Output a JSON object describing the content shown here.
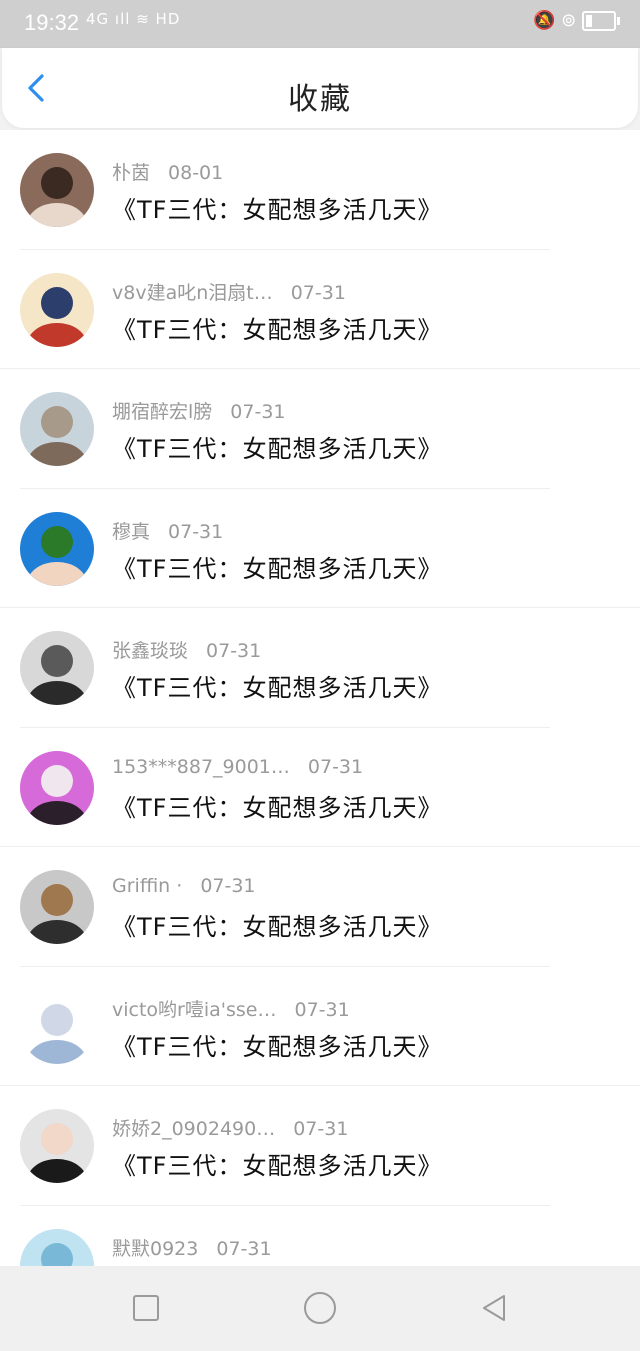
{
  "status": {
    "time": "19:32",
    "signal": "4G ıll ≋ HD",
    "right_icons": "🔕 ⊚"
  },
  "header": {
    "title": "收藏",
    "back_icon": "chevron-left-icon",
    "accent": "#2e8ff0"
  },
  "items": [
    {
      "user": "朴茵",
      "date": "08-01",
      "book": "《TF三代：女配想多活几天》",
      "avatar_colors": [
        "#8a6a5a",
        "#e8d8cc",
        "#3a2a22"
      ]
    },
    {
      "user": "v8v建a叱n泪扇t…",
      "date": "07-31",
      "book": "《TF三代：女配想多活几天》",
      "avatar_colors": [
        "#f5e6c8",
        "#c0392b",
        "#2c3e6b"
      ]
    },
    {
      "user": "堋宿醉宏l膀",
      "date": "07-31",
      "book": "《TF三代：女配想多活几天》",
      "avatar_colors": [
        "#c8d4dc",
        "#7d6a5a",
        "#a89a8a"
      ]
    },
    {
      "user": "穆真",
      "date": "07-31",
      "book": "《TF三代：女配想多活几天》",
      "avatar_colors": [
        "#1f7fd6",
        "#f2d5c0",
        "#2a7a2a"
      ]
    },
    {
      "user": "张鑫琰琰",
      "date": "07-31",
      "book": "《TF三代：女配想多活几天》",
      "avatar_colors": [
        "#d8d8d8",
        "#2a2a2a",
        "#5a5a5a"
      ]
    },
    {
      "user": "153***887_9001…",
      "date": "07-31",
      "book": "《TF三代：女配想多活几天》",
      "avatar_colors": [
        "#d66ad8",
        "#2a1f2a",
        "#f0e6ee"
      ]
    },
    {
      "user": "Griffin ·",
      "date": "07-31",
      "book": "《TF三代：女配想多活几天》",
      "avatar_colors": [
        "#c8c8c8",
        "#2e2e2e",
        "#a07850"
      ]
    },
    {
      "user": "victo哟r噎ia'sse…",
      "date": "07-31",
      "book": "《TF三代：女配想多活几天》",
      "avatar_colors": [
        "#ffffff",
        "#9fb7d6",
        "#d0d8e8"
      ]
    },
    {
      "user": "娇娇2_0902490…",
      "date": "07-31",
      "book": "《TF三代：女配想多活几天》",
      "avatar_colors": [
        "#e4e4e4",
        "#1a1a1a",
        "#f1d8c8"
      ]
    },
    {
      "user": "默默0923",
      "date": "07-31",
      "book": "",
      "avatar_colors": [
        "#bfe3f0",
        "#ffffff",
        "#7ab8d8"
      ]
    }
  ],
  "navbar": {
    "icons": [
      "square-icon",
      "circle-icon",
      "triangle-back-icon"
    ]
  }
}
